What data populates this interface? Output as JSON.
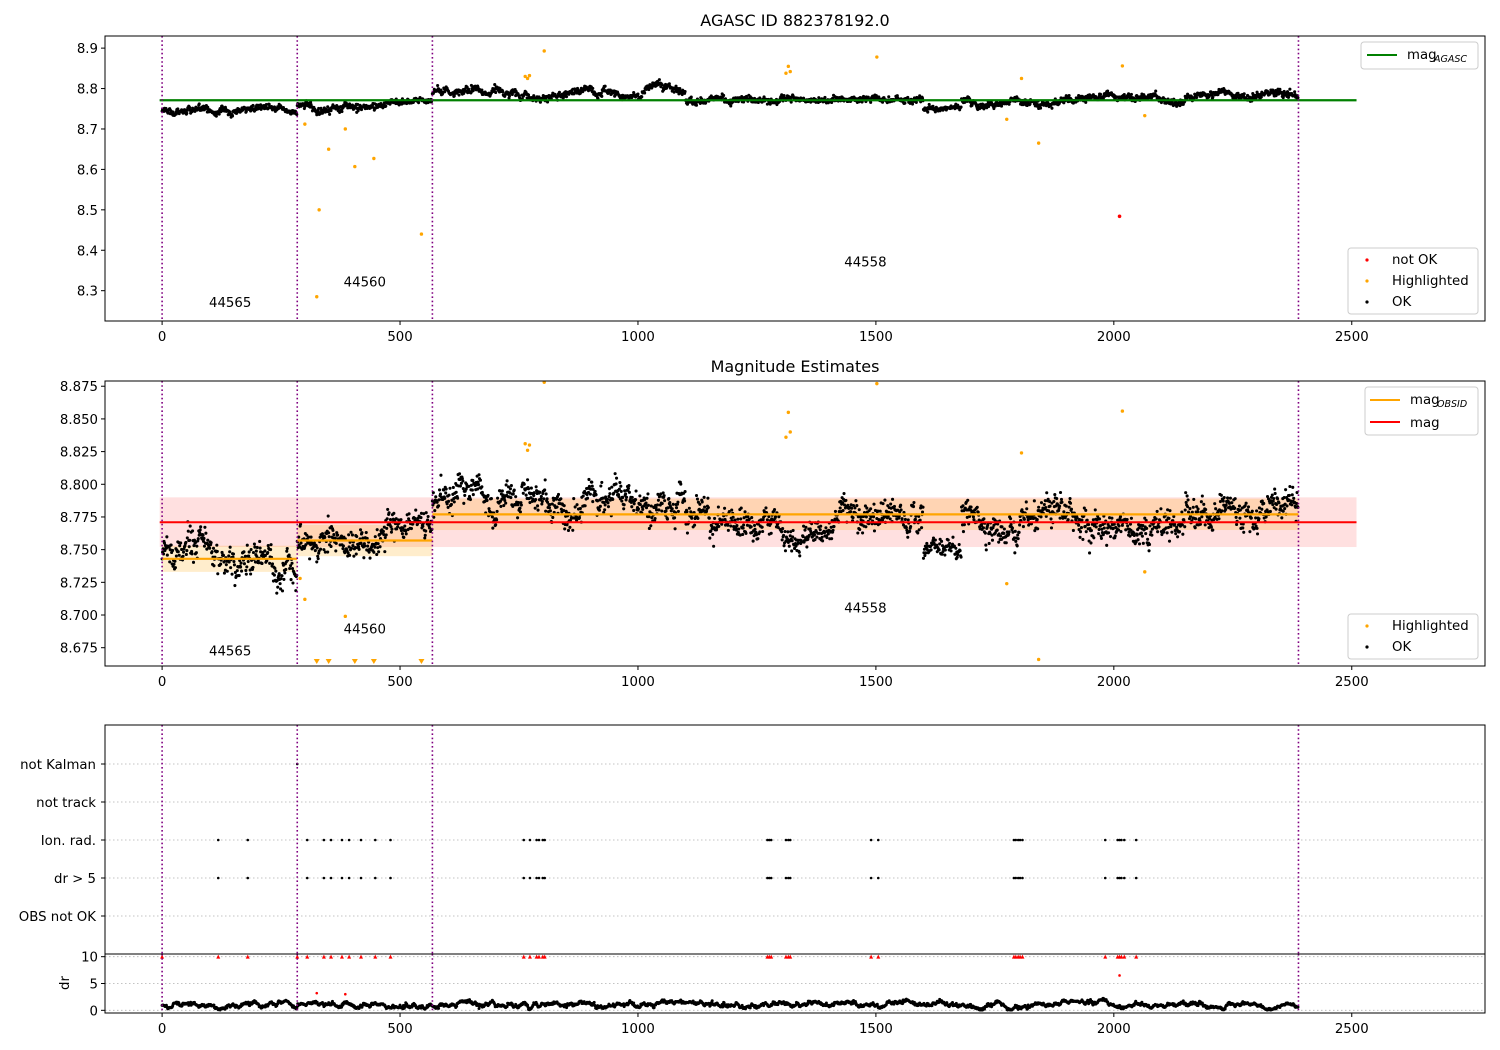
{
  "chart_data": [
    {
      "type": "scatter",
      "title": "AGASC ID 882378192.0",
      "xlabel": "",
      "ylabel": "",
      "xlim": [
        -120,
        2780
      ],
      "ylim": [
        8.225,
        8.93
      ],
      "xticks": [
        0,
        500,
        1000,
        1500,
        2000,
        2500
      ],
      "yticks": [
        8.3,
        8.4,
        8.5,
        8.6,
        8.7,
        8.8,
        8.9
      ],
      "ytick_labels": [
        "8.3",
        "8.4",
        "8.5",
        "8.6",
        "8.7",
        "8.8",
        "8.9"
      ],
      "obs_boundaries": [
        0,
        284,
        568,
        2388
      ],
      "obs_labels": [
        {
          "text": "44565",
          "x": 143,
          "y": 8.26
        },
        {
          "text": "44560",
          "x": 426,
          "y": 8.31
        },
        {
          "text": "44558",
          "x": 1478,
          "y": 8.36
        }
      ],
      "hlines": [
        {
          "name": "mag_AGASC",
          "value": 8.771,
          "x_range": [
            -5,
            2510
          ],
          "color": "#008000"
        }
      ],
      "segments": [
        {
          "x_range": [
            0,
            284
          ],
          "center": 8.745,
          "amp": 0.006,
          "noise": 0.007
        },
        {
          "x_range": [
            284,
            480
          ],
          "center": 8.757,
          "amp": 0.005,
          "noise": 0.008
        },
        {
          "x_range": [
            480,
            568
          ],
          "center": 8.77,
          "amp": 0.004,
          "noise": 0.008
        },
        {
          "x_range": [
            568,
            1100
          ],
          "center": 8.788,
          "amp": 0.008,
          "noise": 0.007
        },
        {
          "x_range": [
            1100,
            1600
          ],
          "center": 8.772,
          "amp": 0.005,
          "noise": 0.007
        },
        {
          "x_range": [
            1600,
            1680
          ],
          "center": 8.748,
          "amp": 0.003,
          "noise": 0.005
        },
        {
          "x_range": [
            1680,
            2150
          ],
          "center": 8.771,
          "amp": 0.006,
          "noise": 0.007
        },
        {
          "x_range": [
            2150,
            2388
          ],
          "center": 8.783,
          "amp": 0.007,
          "noise": 0.007
        }
      ],
      "highlighted_points": [
        {
          "x": 300,
          "y": 8.712
        },
        {
          "x": 325,
          "y": 8.285
        },
        {
          "x": 330,
          "y": 8.5
        },
        {
          "x": 350,
          "y": 8.65
        },
        {
          "x": 385,
          "y": 8.7
        },
        {
          "x": 405,
          "y": 8.607
        },
        {
          "x": 445,
          "y": 8.627
        },
        {
          "x": 545,
          "y": 8.44
        },
        {
          "x": 763,
          "y": 8.83
        },
        {
          "x": 768,
          "y": 8.825
        },
        {
          "x": 772,
          "y": 8.832
        },
        {
          "x": 803,
          "y": 8.893
        },
        {
          "x": 1311,
          "y": 8.838
        },
        {
          "x": 1316,
          "y": 8.855
        },
        {
          "x": 1320,
          "y": 8.842
        },
        {
          "x": 1502,
          "y": 8.878
        },
        {
          "x": 1775,
          "y": 8.724
        },
        {
          "x": 1806,
          "y": 8.825
        },
        {
          "x": 1842,
          "y": 8.665
        },
        {
          "x": 2018,
          "y": 8.856
        },
        {
          "x": 2065,
          "y": 8.733
        }
      ],
      "not_ok_points": [
        {
          "x": 2012,
          "y": 8.484
        }
      ],
      "legends": [
        {
          "position": "upper right",
          "entries": [
            {
              "label": "mag",
              "subscript": "AGASC",
              "kind": "line",
              "color": "#008000"
            }
          ]
        },
        {
          "position": "lower right",
          "entries": [
            {
              "label": "not OK",
              "kind": "marker",
              "color": "#ff0000"
            },
            {
              "label": "Highlighted",
              "kind": "marker",
              "color": "#ffa500"
            },
            {
              "label": "OK",
              "kind": "marker",
              "color": "#000000"
            }
          ]
        }
      ]
    },
    {
      "type": "scatter",
      "title": "Magnitude Estimates",
      "xlabel": "",
      "ylabel": "",
      "xlim": [
        -120,
        2780
      ],
      "ylim": [
        8.661,
        8.879
      ],
      "xticks": [
        0,
        500,
        1000,
        1500,
        2000,
        2500
      ],
      "yticks": [
        8.675,
        8.7,
        8.725,
        8.75,
        8.775,
        8.8,
        8.825,
        8.85,
        8.875
      ],
      "ytick_labels": [
        "8.675",
        "8.700",
        "8.725",
        "8.750",
        "8.775",
        "8.800",
        "8.825",
        "8.850",
        "8.875"
      ],
      "obs_boundaries": [
        0,
        284,
        568,
        2388
      ],
      "obs_labels": [
        {
          "text": "44565",
          "x": 143,
          "y": 8.669
        },
        {
          "text": "44560",
          "x": 426,
          "y": 8.686
        },
        {
          "text": "44558",
          "x": 1478,
          "y": 8.702
        }
      ],
      "mag": {
        "name": "mag",
        "value": 8.771,
        "band": [
          8.752,
          8.79
        ],
        "x_range": [
          -5,
          2510
        ],
        "color": "#ff0000"
      },
      "mag_obsid": [
        {
          "x_range": [
            0,
            284
          ],
          "value": 8.743,
          "band": [
            8.733,
            8.753
          ]
        },
        {
          "x_range": [
            284,
            568
          ],
          "value": 8.757,
          "band": [
            8.745,
            8.769
          ]
        },
        {
          "x_range": [
            568,
            2388
          ],
          "value": 8.777,
          "band": [
            8.765,
            8.789
          ]
        }
      ],
      "segments": [
        {
          "x_range": [
            0,
            284
          ],
          "center": 8.743,
          "amp": 0.008,
          "noise": 0.009
        },
        {
          "x_range": [
            284,
            480
          ],
          "center": 8.755,
          "amp": 0.006,
          "noise": 0.01
        },
        {
          "x_range": [
            480,
            568
          ],
          "center": 8.768,
          "amp": 0.004,
          "noise": 0.009
        },
        {
          "x_range": [
            568,
            1100
          ],
          "center": 8.788,
          "amp": 0.008,
          "noise": 0.009
        },
        {
          "x_range": [
            1100,
            1600
          ],
          "center": 8.772,
          "amp": 0.006,
          "noise": 0.009
        },
        {
          "x_range": [
            1600,
            1680
          ],
          "center": 8.747,
          "amp": 0.004,
          "noise": 0.006
        },
        {
          "x_range": [
            1680,
            2150
          ],
          "center": 8.771,
          "amp": 0.007,
          "noise": 0.009
        },
        {
          "x_range": [
            2150,
            2388
          ],
          "center": 8.784,
          "amp": 0.008,
          "noise": 0.009
        }
      ],
      "highlighted_points": [
        {
          "x": 290,
          "y": 8.728
        },
        {
          "x": 300,
          "y": 8.712
        },
        {
          "x": 385,
          "y": 8.699
        },
        {
          "x": 763,
          "y": 8.831
        },
        {
          "x": 768,
          "y": 8.826
        },
        {
          "x": 772,
          "y": 8.83
        },
        {
          "x": 803,
          "y": 8.878
        },
        {
          "x": 1311,
          "y": 8.836
        },
        {
          "x": 1316,
          "y": 8.855
        },
        {
          "x": 1320,
          "y": 8.84
        },
        {
          "x": 1502,
          "y": 8.877
        },
        {
          "x": 1775,
          "y": 8.724
        },
        {
          "x": 1806,
          "y": 8.824
        },
        {
          "x": 1842,
          "y": 8.666
        },
        {
          "x": 2018,
          "y": 8.856
        },
        {
          "x": 2065,
          "y": 8.733
        }
      ],
      "offscale_low_points": [
        {
          "x": 325
        },
        {
          "x": 350
        },
        {
          "x": 405
        },
        {
          "x": 445
        },
        {
          "x": 545
        }
      ],
      "legends": [
        {
          "position": "upper right",
          "entries": [
            {
              "label": "mag",
              "subscript": "OBSID",
              "kind": "line",
              "color": "#ffa500"
            },
            {
              "label": "mag",
              "kind": "line",
              "color": "#ff0000"
            }
          ]
        },
        {
          "position": "lower right",
          "entries": [
            {
              "label": "Highlighted",
              "kind": "marker",
              "color": "#ffa500"
            },
            {
              "label": "OK",
              "kind": "marker",
              "color": "#000000"
            }
          ]
        }
      ]
    },
    {
      "type": "scatter",
      "title": "",
      "xlabel": "",
      "ylabel": "",
      "xlim": [
        -120,
        2780
      ],
      "flag_rows": [
        "not Kalman",
        "not track",
        "Ion. rad.",
        "dr > 5",
        "OBS not OK"
      ],
      "obs_boundaries": [
        0,
        284,
        568,
        2388
      ],
      "flags": {
        "not Kalman": [
          284
        ],
        "not track": [],
        "Ion. rad.": [
          118,
          180,
          305,
          340,
          355,
          378,
          393,
          418,
          448,
          480,
          760,
          773,
          787,
          792,
          800,
          804,
          1272,
          1276,
          1280,
          1311,
          1316,
          1320,
          1490,
          1505,
          1790,
          1794,
          1799,
          1803,
          1808,
          1982,
          2008,
          2012,
          2016,
          2022,
          2047
        ],
        "dr > 5": [
          118,
          180,
          305,
          340,
          355,
          378,
          393,
          418,
          448,
          480,
          760,
          773,
          787,
          792,
          800,
          804,
          1272,
          1276,
          1280,
          1311,
          1316,
          1320,
          1490,
          1505,
          1790,
          1794,
          1799,
          1803,
          1808,
          1982,
          2008,
          2012,
          2016,
          2022,
          2047
        ],
        "OBS not OK": []
      }
    },
    {
      "type": "scatter",
      "title": "",
      "xlabel": "",
      "ylabel": "dr",
      "xlim": [
        -120,
        2780
      ],
      "ylim": [
        -0.5,
        10.5
      ],
      "xticks": [
        0,
        500,
        1000,
        1500,
        2000,
        2500
      ],
      "yticks": [
        0,
        5,
        10
      ],
      "ytick_labels": [
        "0",
        "5",
        "10"
      ],
      "obs_boundaries": [
        0,
        284,
        568,
        2388
      ],
      "clipped_at": 10,
      "clipped_points": [
        0,
        118,
        180,
        284,
        305,
        340,
        355,
        378,
        393,
        418,
        448,
        480,
        760,
        773,
        787,
        792,
        800,
        804,
        1272,
        1276,
        1280,
        1311,
        1316,
        1320,
        1490,
        1505,
        1790,
        1794,
        1799,
        1803,
        1808,
        1982,
        2008,
        2012,
        2016,
        2022,
        2047
      ],
      "red_points": [
        {
          "x": 325,
          "y": 3.2
        },
        {
          "x": 385,
          "y": 3.0
        },
        {
          "x": 2012,
          "y": 6.5
        }
      ],
      "baseline": {
        "mean": 0.9,
        "amp": 0.4,
        "noise": 0.3,
        "x_range": [
          0,
          2388
        ]
      }
    }
  ]
}
